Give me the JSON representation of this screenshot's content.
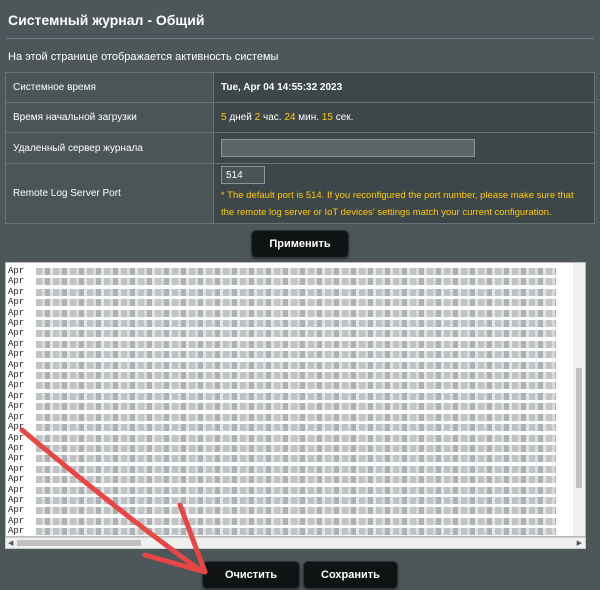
{
  "header": {
    "title": "Системный журнал - Общий",
    "subtitle": "На этой странице отображается активность системы"
  },
  "form": {
    "system_time_label": "Системное время",
    "system_time_value": "Tue, Apr 04 14:55:32 2023",
    "uptime_label": "Время начальной загрузки",
    "uptime": {
      "days": "5",
      "days_unit": "дней",
      "hours": "2",
      "hours_unit": "час.",
      "minutes": "24",
      "minutes_unit": "мин.",
      "seconds": "15",
      "seconds_unit": "сек."
    },
    "remote_server_label": "Удаленный сервер журнала",
    "remote_server_value": "",
    "remote_port_label": "Remote Log Server Port",
    "remote_port_value": "514",
    "port_note": "* The default port is 514. If you reconfigured the port number, please make sure that the remote log server or IoT devices' settings match your current configuration."
  },
  "buttons": {
    "apply": "Применить",
    "clear": "Очистить",
    "save": "Сохранить"
  },
  "log": {
    "lines": [
      "Apr",
      "Apr",
      "Apr",
      "Apr",
      "Apr",
      "Apr",
      "Apr",
      "Apr",
      "Apr",
      "Apr",
      "Apr",
      "Apr",
      "Apr",
      "Apr",
      "Apr",
      "Apr",
      "Apr",
      "Apr",
      "Apr",
      "Apr",
      "Apr",
      "Apr",
      "Apr",
      "Apr",
      "Apr",
      "Apr"
    ]
  },
  "colors": {
    "background": "#4d5659",
    "accent_yellow": "#ffcc00",
    "annotation_arrow": "#e84545"
  }
}
